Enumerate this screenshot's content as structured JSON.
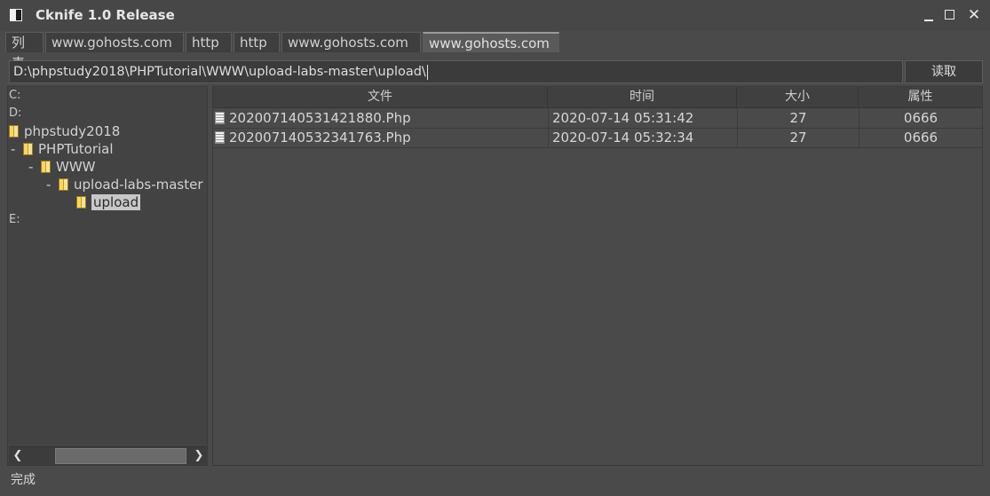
{
  "window": {
    "title": "Cknife 1.0 Release",
    "minimize": "—",
    "maximize": "☐",
    "close": "✕"
  },
  "tabs": [
    {
      "label": "列表"
    },
    {
      "label": "www.gohosts.com"
    },
    {
      "label": "http"
    },
    {
      "label": "http"
    },
    {
      "label": "www.gohosts.com"
    },
    {
      "label": "www.gohosts.com",
      "active": true
    }
  ],
  "pathbar": {
    "value": "D:\\phpstudy2018\\PHPTutorial\\WWW\\upload-labs-master\\upload\\",
    "read_button": "读取"
  },
  "tree": {
    "drives": [
      "C:",
      "D:",
      "E:"
    ],
    "folders": [
      "phpstudy2018",
      "PHPTutorial",
      "WWW",
      "upload-labs-master",
      "upload"
    ],
    "dash": "-",
    "scroll_left": "❮",
    "scroll_right": "❯"
  },
  "files": {
    "columns": [
      "文件",
      "时间",
      "大小",
      "属性"
    ],
    "rows": [
      {
        "name": "202007140531421880.Php",
        "time": "2020-07-14 05:31:42",
        "size": "27",
        "attr": "0666"
      },
      {
        "name": "202007140532341763.Php",
        "time": "2020-07-14 05:32:34",
        "size": "27",
        "attr": "0666"
      }
    ]
  },
  "status": "完成"
}
